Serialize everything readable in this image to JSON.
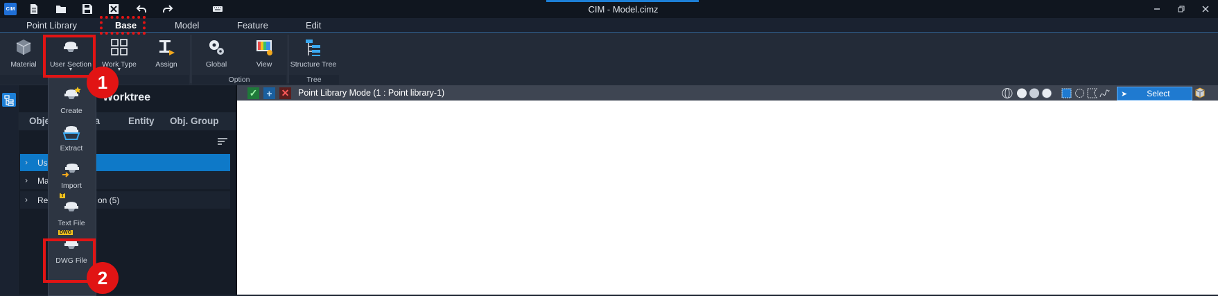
{
  "app": {
    "logo_text": "CIM",
    "window_title": "CIM - Model.cimz"
  },
  "quick_access": [
    "new-file-icon",
    "open-folder-icon",
    "save-icon",
    "close-file-icon",
    "undo-icon",
    "redo-icon",
    "keyboard-icon"
  ],
  "ribbon_tabs": [
    "Point Library",
    "Base",
    "Model",
    "Feature",
    "Edit"
  ],
  "ribbon": {
    "material": "Material",
    "user_section": "User Section",
    "work_type": "Work Type",
    "assign": "Assign",
    "global": "Global",
    "view": "View",
    "structure_tree": "Structure Tree",
    "group_option": "Option",
    "group_tree": "Tree"
  },
  "worktree": {
    "title": "Worktree",
    "tabs": [
      "Obje",
      "ta",
      "Entity",
      "Obj. Group"
    ],
    "rows": [
      "Us",
      "Ma",
      "Re",
      "on (5)"
    ]
  },
  "dropdown": {
    "items": [
      "Create",
      "Extract",
      "Import",
      "Text File",
      "DWG File"
    ],
    "text_file_badge": "T",
    "dwg_badge": "DWG"
  },
  "viewport": {
    "mode_text": "Point Library Mode (1 : Point library-1)",
    "select_label": "Select"
  },
  "annotations": {
    "step_1": "1",
    "step_2": "2"
  },
  "colors": {
    "accent": "#1d7fd6",
    "annotation_red": "#e11414",
    "selected_row": "#0e79c8"
  }
}
